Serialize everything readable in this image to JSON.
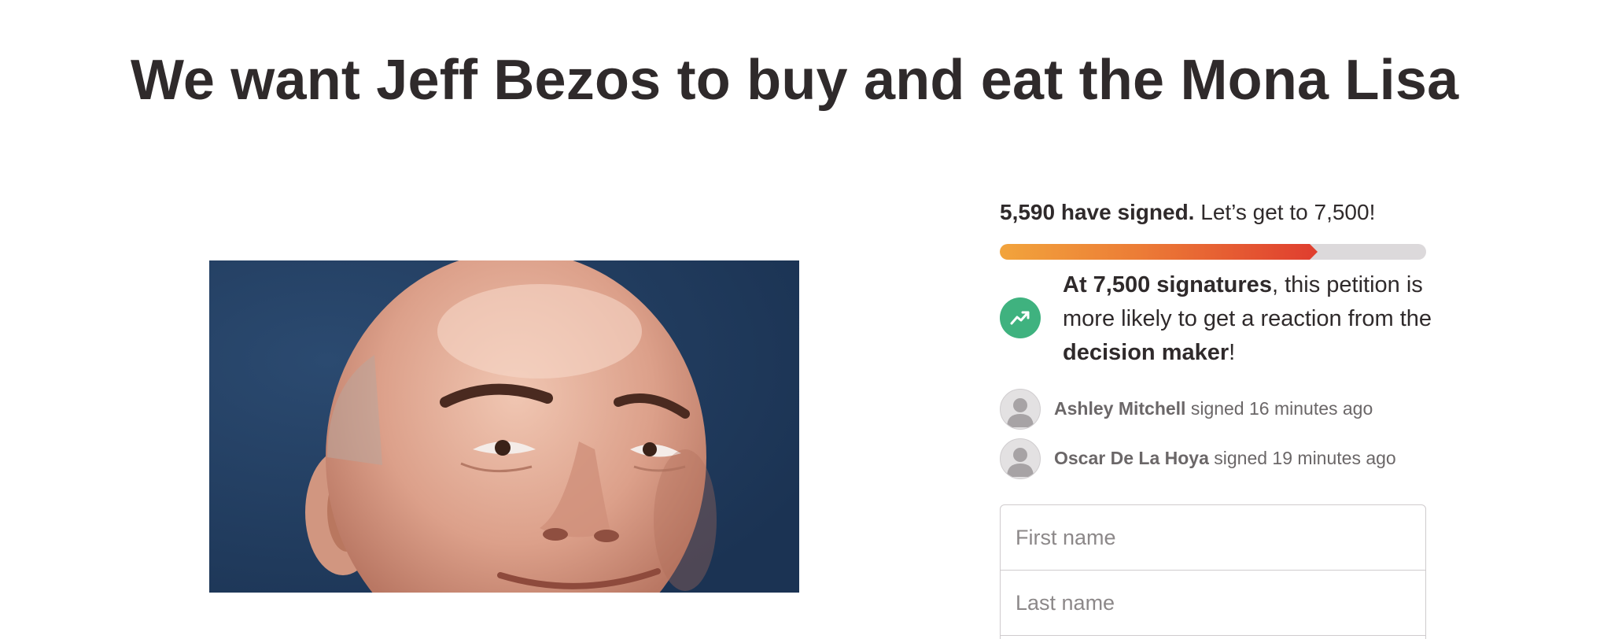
{
  "petition": {
    "title": "We want Jeff Bezos to buy and eat the Mona Lisa"
  },
  "progress": {
    "signed_bold": "5,590 have signed.",
    "goal_text": " Let’s get to 7,500!",
    "signed_count": 5590,
    "goal_count": 7500,
    "fill_fraction": 0.745,
    "colors": {
      "start": "#f2a43c",
      "end": "#e0402f",
      "track": "#dcd9db"
    }
  },
  "milestone": {
    "icon": "trending-up-icon",
    "icon_color": "#3fb27f",
    "bold_lead": "At 7,500 signatures",
    "middle": ", this petition is more likely to get a reaction from the ",
    "bold_tail": "decision maker",
    "end": "!"
  },
  "recent_signers": [
    {
      "name": "Ashley Mitchell",
      "action": " signed 16 minutes ago"
    },
    {
      "name": "Oscar De La Hoya",
      "action": " signed 19 minutes ago"
    }
  ],
  "form": {
    "first_name_placeholder": "First name",
    "last_name_placeholder": "Last name"
  }
}
